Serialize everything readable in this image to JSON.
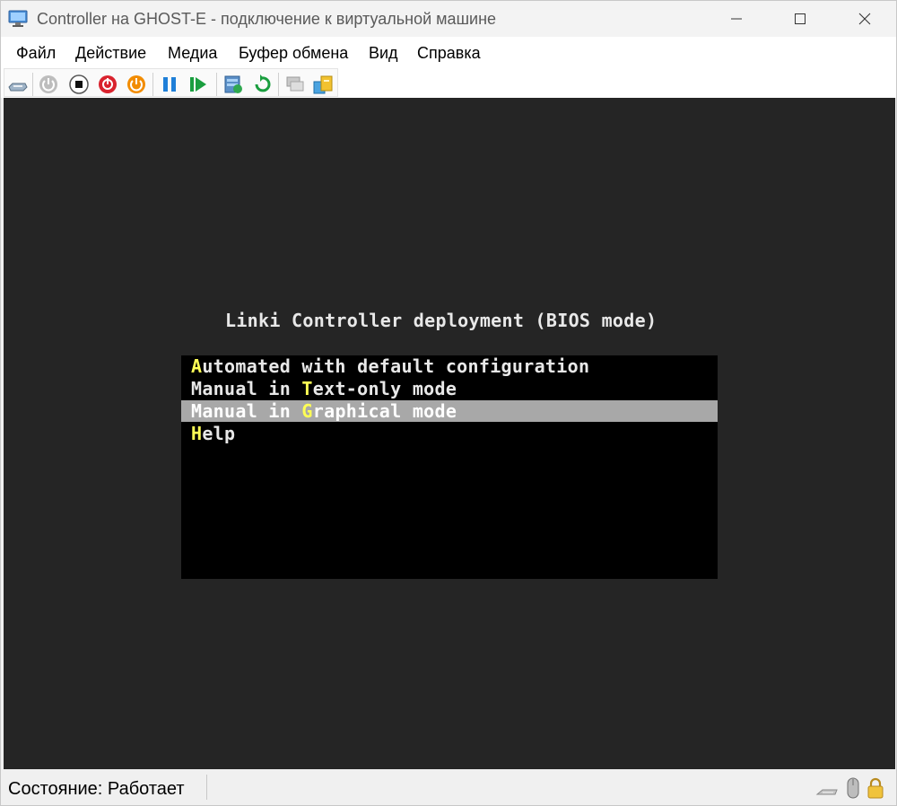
{
  "window": {
    "title": "Controller на GHOST-E - подключение к виртуальной машине"
  },
  "menubar": {
    "items": [
      "Файл",
      "Действие",
      "Медиа",
      "Буфер обмена",
      "Вид",
      "Справка"
    ]
  },
  "toolbar": {
    "buttons": [
      "ctrl-alt-del-icon",
      "start-icon",
      "turn-off-icon",
      "shut-down-icon",
      "save-state-icon",
      "pause-icon",
      "resume-icon",
      "checkpoint-icon",
      "revert-icon",
      "enhanced-session-icon",
      "share-icon"
    ]
  },
  "console": {
    "title": "Linki Controller deployment (BIOS mode)",
    "options": [
      {
        "pre": "",
        "hotkey": "A",
        "post": "utomated with default configuration",
        "selected": false
      },
      {
        "pre": "Manual in ",
        "hotkey": "T",
        "post": "ext-only mode",
        "selected": false
      },
      {
        "pre": "Manual in ",
        "hotkey": "G",
        "post": "raphical mode",
        "selected": true
      },
      {
        "pre": "",
        "hotkey": "H",
        "post": "elp",
        "selected": false
      }
    ],
    "colors": {
      "background": "#252525",
      "menu": "#000000",
      "highlight": "#a8a8a8",
      "hotkey": "#ffff55"
    }
  },
  "statusbar": {
    "status": "Состояние: Работает"
  }
}
